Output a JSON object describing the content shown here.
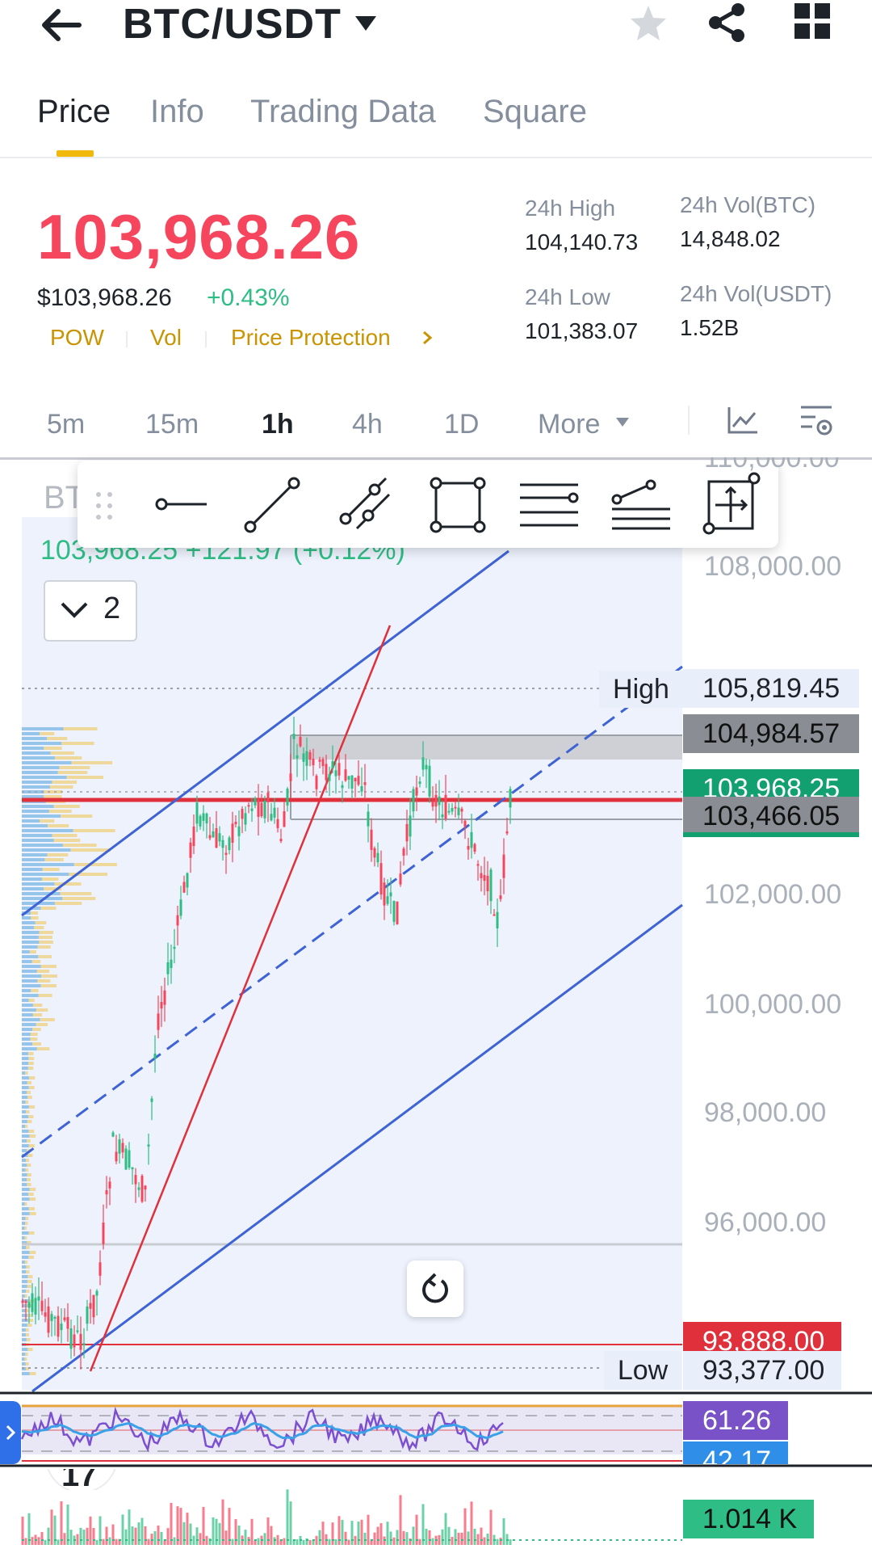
{
  "header": {
    "pair": "BTC/USDT",
    "icons": [
      "back-arrow-icon",
      "caret-down-icon",
      "star-icon",
      "share-icon",
      "grid-icon"
    ]
  },
  "tabs": [
    {
      "label": "Price",
      "active": true
    },
    {
      "label": "Info",
      "active": false
    },
    {
      "label": "Trading Data",
      "active": false
    },
    {
      "label": "Square",
      "active": false
    }
  ],
  "ticker": {
    "last_price": "103,968.26",
    "fiat_price": "$103,968.26",
    "change": "+0.43%",
    "tags": [
      "POW",
      "Vol",
      "Price Protection"
    ],
    "high_label": "24h High",
    "high_value": "104,140.73",
    "low_label": "24h Low",
    "low_value": "101,383.07",
    "vol_btc_label": "24h Vol(BTC)",
    "vol_btc_value": "14,848.02",
    "vol_usdt_label": "24h Vol(USDT)",
    "vol_usdt_value": "1.52B"
  },
  "timeframes": [
    {
      "label": "5m",
      "active": false
    },
    {
      "label": "15m",
      "active": false
    },
    {
      "label": "1h",
      "active": true
    },
    {
      "label": "4h",
      "active": false
    },
    {
      "label": "1D",
      "active": false
    },
    {
      "label": "More",
      "active": false
    }
  ],
  "chart": {
    "legend_symbol": "BT",
    "legend_ohlc": "103,968.25  +121.97 (+0.12%)",
    "collapse_count": "2",
    "y_axis_labels": [
      "108,000.00",
      "102,000.00",
      "100,000.00",
      "98,000.00",
      "96,000.00"
    ],
    "top_partial_label": "110,000.00",
    "high_label": "High",
    "high_value": "105,819.45",
    "level_1": "104,984.57",
    "current_price": "103,968.25",
    "level_2": "103,466.05",
    "red_level": "93,888.00",
    "low_label": "Low",
    "low_value": "93,377.00",
    "colors": {
      "up": "#2ebd85",
      "down": "#f6465d",
      "trend": "#3e63d4",
      "accent": "#f0b90b"
    }
  },
  "indicator": {
    "rsi_value_1": "61.26",
    "rsi_value_2": "42.17",
    "volume_value": "1.014 K"
  }
}
